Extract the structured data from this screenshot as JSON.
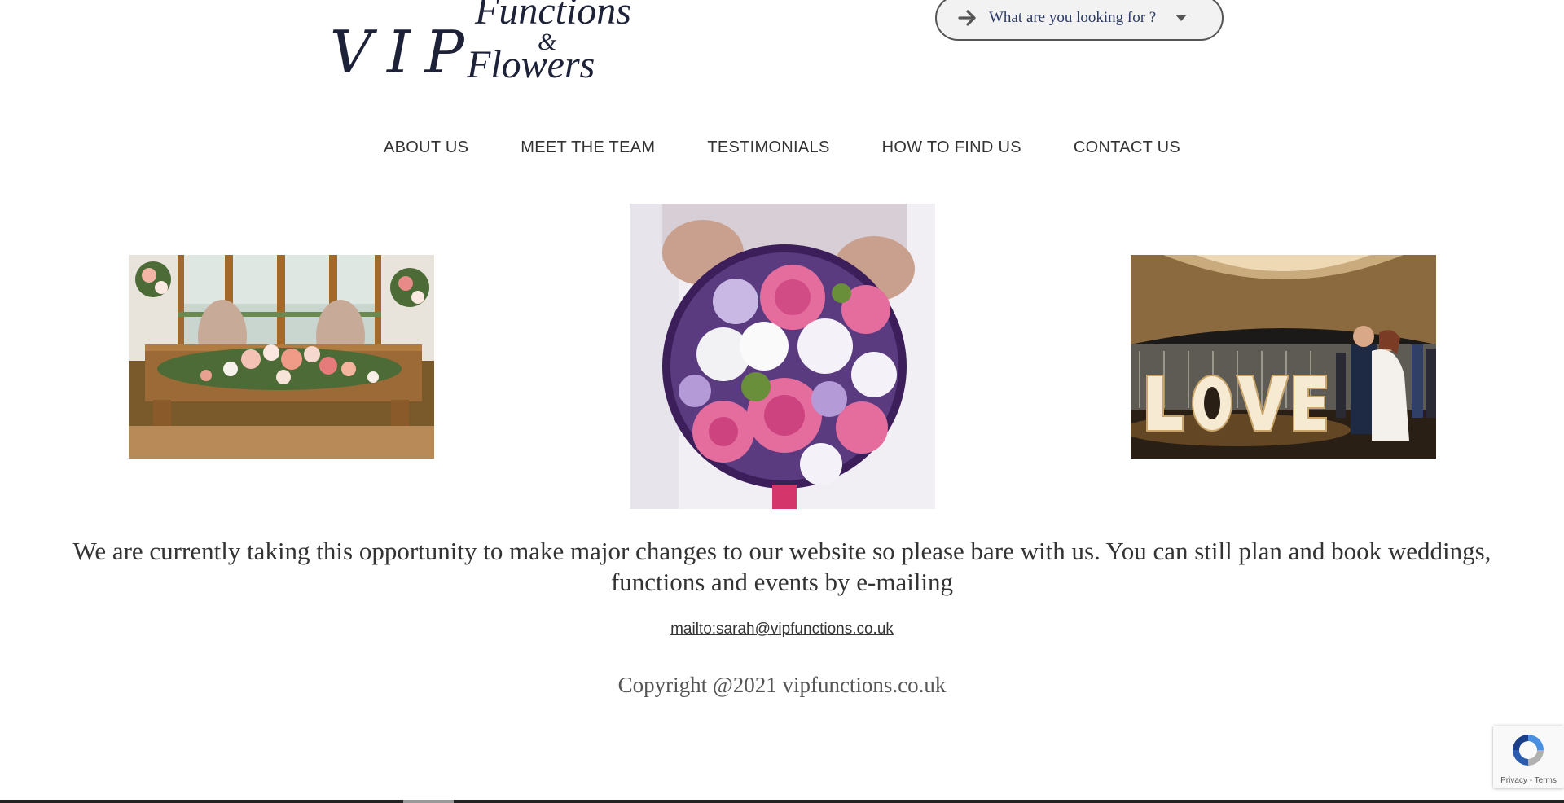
{
  "logo": {
    "vip": "VIP",
    "functions": "Functions",
    "amp": "&",
    "flowers": "Flowers"
  },
  "dropdown": {
    "label": "What are you looking for ?",
    "icon": "arrow-right-icon"
  },
  "nav": {
    "items": [
      "ABOUT US",
      "MEET THE TEAM",
      "TESTIMONIALS",
      "HOW TO FIND US",
      "CONTACT US"
    ]
  },
  "main": {
    "notice": "We are currently taking this opportunity to make major changes to our website so please bare with us. You can still plan and book weddings, functions and events by e-mailing",
    "email_link": "mailto:sarah@vipfunctions.co.uk",
    "copyright": "Copyright @2021 vipfunctions.co.uk"
  },
  "recaptcha": {
    "privacy": "Privacy",
    "separator": " - ",
    "terms": "Terms"
  },
  "colors": {
    "text": "#333333",
    "logo": "#1e2238",
    "dropdown_text": "#2c3a66",
    "dropdown_bg": "#f2f2f2"
  }
}
